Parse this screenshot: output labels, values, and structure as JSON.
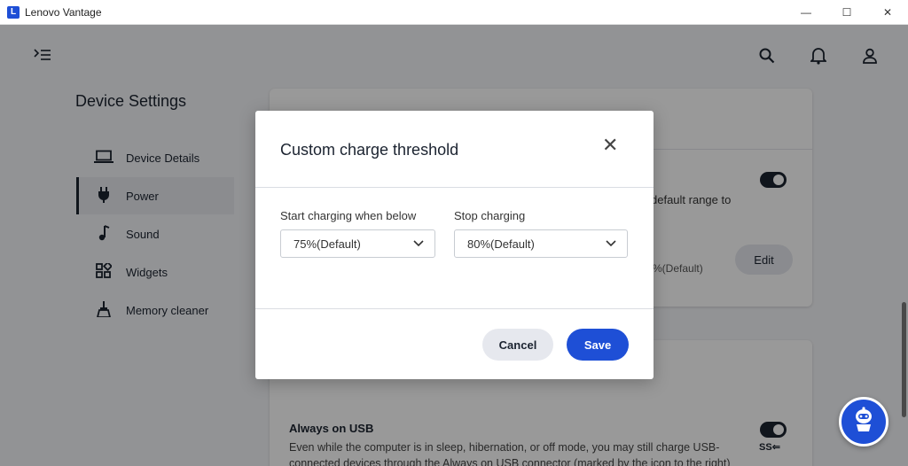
{
  "window": {
    "title": "Lenovo Vantage",
    "logo_letter": "L",
    "minimize": "—",
    "maximize": "☐",
    "close": "✕"
  },
  "sidebar": {
    "title": "Device Settings",
    "items": [
      {
        "label": "Device Details",
        "icon": "laptop-icon"
      },
      {
        "label": "Power",
        "icon": "plug-icon"
      },
      {
        "label": "Sound",
        "icon": "music-note-icon"
      },
      {
        "label": "Widgets",
        "icon": "widgets-icon"
      },
      {
        "label": "Memory cleaner",
        "icon": "broom-icon"
      }
    ],
    "active_index": 1
  },
  "background": {
    "partial_text_1": "default range to",
    "partial_text_2": "%(Default)",
    "edit_label": "Edit",
    "usb_title": "Always on USB",
    "usb_desc_1": "Even while the computer is in sleep, hibernation, or off mode, you may still charge USB-",
    "usb_desc_2": "connected devices through the Always on USB connector (marked by the icon to the right)",
    "usb_icon_text": "SS"
  },
  "dialog": {
    "title": "Custom charge threshold",
    "close_glyph": "✕",
    "start_label": "Start charging when below",
    "start_value": "75%(Default)",
    "stop_label": "Stop charging",
    "stop_value": "80%(Default)",
    "cancel_label": "Cancel",
    "save_label": "Save"
  },
  "colors": {
    "accent": "#1e4fd6",
    "dark": "#1b2330",
    "cancel_bg": "#e6e8ee"
  }
}
